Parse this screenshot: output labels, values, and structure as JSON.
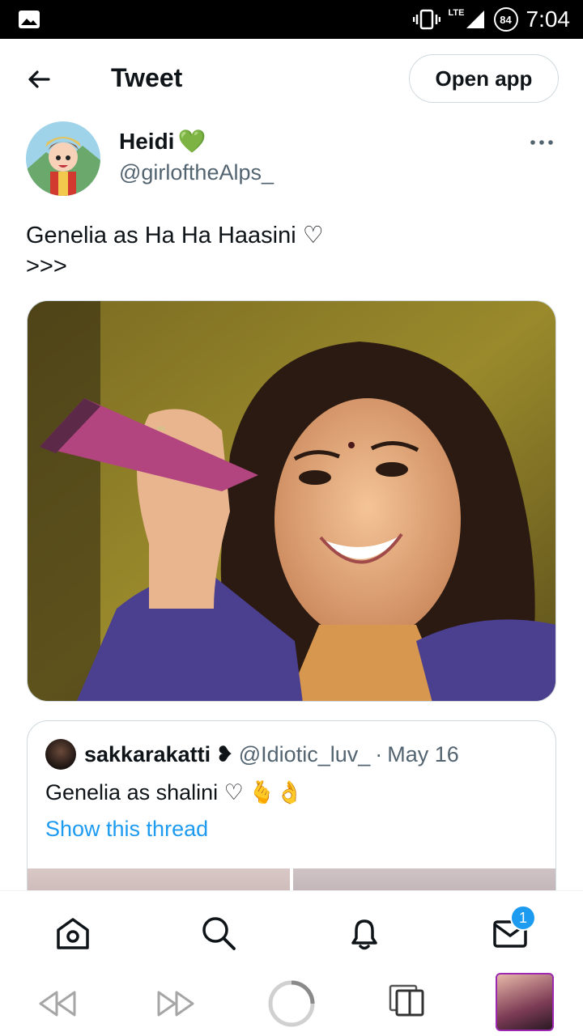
{
  "status_bar": {
    "time": "7:04",
    "battery": "84",
    "network": "LTE"
  },
  "header": {
    "title": "Tweet",
    "open_app_label": "Open app"
  },
  "author": {
    "name": "Heidi",
    "emoji": "💚",
    "handle": "@girloftheAlps_"
  },
  "tweet": {
    "line1": "Genelia as Ha Ha Haasini ♡",
    "line2": ">>>"
  },
  "quote": {
    "name": "sakkarakatti",
    "name_emoji": "❥",
    "handle": "@Idiotic_luv_",
    "dot": "·",
    "date": "May 16",
    "text": "Genelia as shalini ♡",
    "emojis": "🫰👌",
    "show_thread": "Show this thread"
  },
  "nav": {
    "messages_badge": "1"
  },
  "colors": {
    "accent": "#1d9bf0",
    "text": "#0f1419",
    "secondary": "#536471",
    "border": "#cfd9de"
  }
}
